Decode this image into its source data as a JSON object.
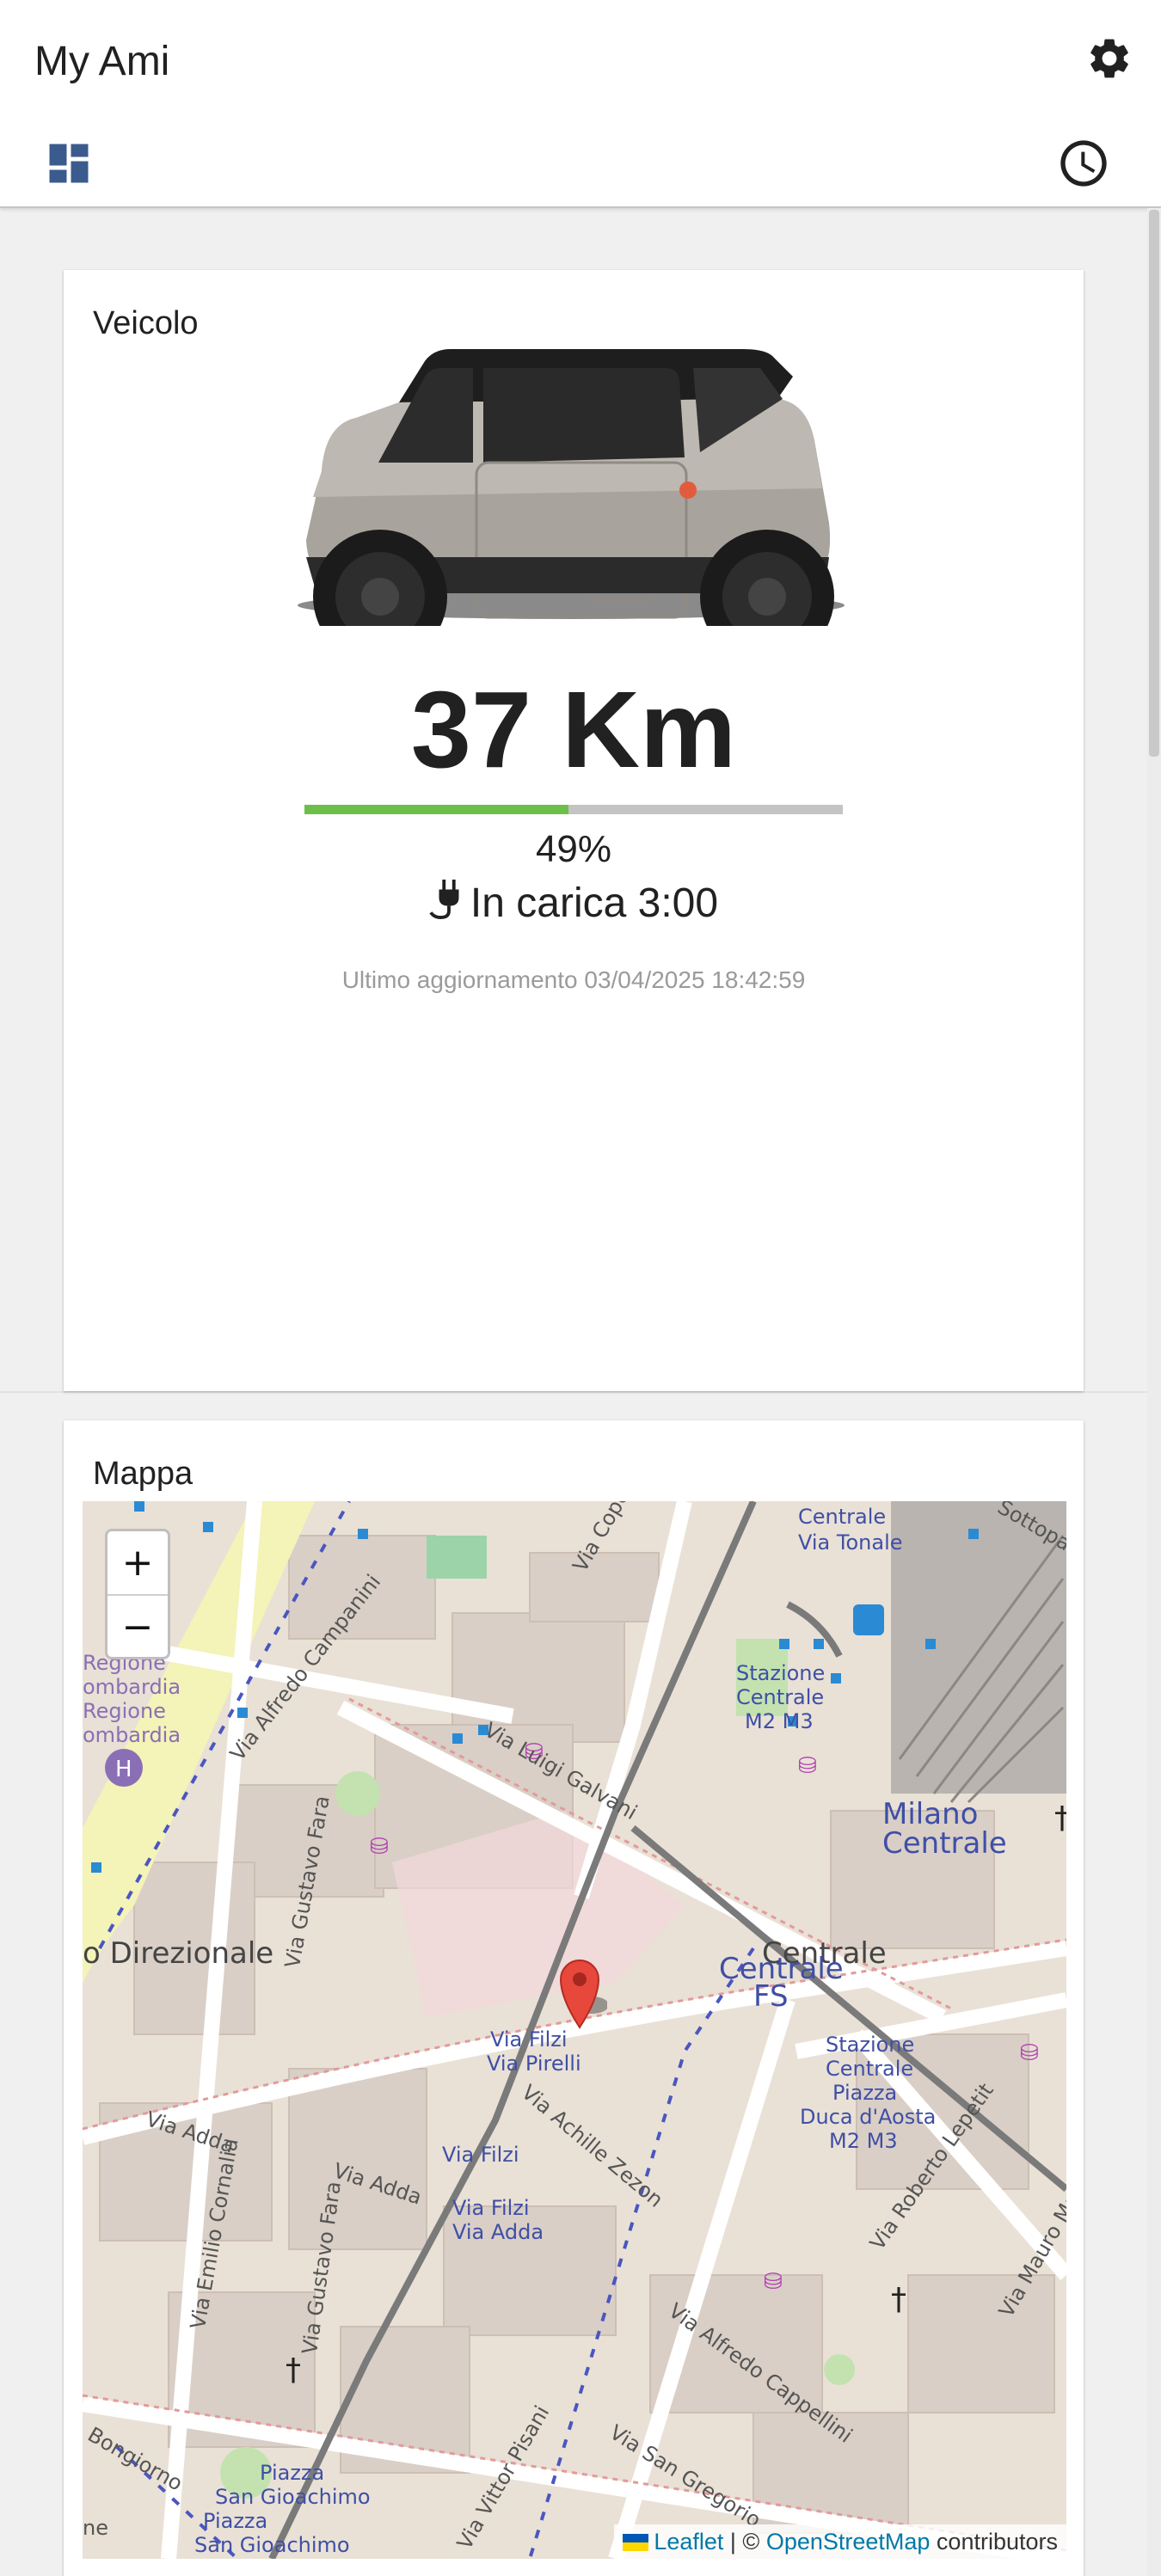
{
  "app": {
    "title": "My Ami"
  },
  "tabs": [
    {
      "name": "dashboard",
      "icon": "dashboard-icon",
      "selected": true,
      "color": "#3b5b8f"
    },
    {
      "name": "history",
      "icon": "clock-icon",
      "selected": false
    }
  ],
  "vehicle": {
    "card_title": "Veicolo",
    "range": "37 Km",
    "battery_percent": 49,
    "battery_label": "49%",
    "charging_status": "In carica 3:00",
    "last_update": "Ultimo aggiornamento 03/04/2025 18:42:59",
    "battery_colors": {
      "fill": "#6cc04a",
      "empty": "#c4c4c4"
    }
  },
  "map": {
    "card_title": "Mappa",
    "zoom_in": "+",
    "zoom_out": "−",
    "attribution": {
      "leaflet": "Leaflet",
      "separator": " | © ",
      "osm": "OpenStreetMap",
      "suffix": " contributors"
    },
    "labels": [
      "Via Cope",
      "Centrale",
      "Via Tonale",
      "Sottopa",
      "Stazione",
      "Centrale",
      "M2 M3",
      "Regione",
      "ombardia",
      "Regione",
      "ombardia",
      "Via Alfredo Campanini",
      "Via Luigi Galvani",
      "Milano",
      "Centrale",
      "Centrale",
      "Centrale",
      "FS",
      "o Direzionale",
      "Via Gustavo Fara",
      "Via Filzi",
      "Via Pirelli",
      "Stazione",
      "Centrale",
      "Piazza",
      "Duca d'Aosta",
      "M2 M3",
      "Via Adda",
      "Via Achille Zezon",
      "Via Roberto Lepetit",
      "Via Adda",
      "Via Filzi",
      "Via Filzi",
      "Via Adda",
      "Via Emilio Cornalia",
      "Via Gustavo Fara",
      "Via Mauro Macchi",
      "Via Alfredo Cappellini",
      "Bongiorno",
      "Piazza",
      "San Gioachimo",
      "Piazza",
      "San Gioachimo",
      "Via Vittor Pisani",
      "Via San Gregorio",
      "ne"
    ]
  }
}
